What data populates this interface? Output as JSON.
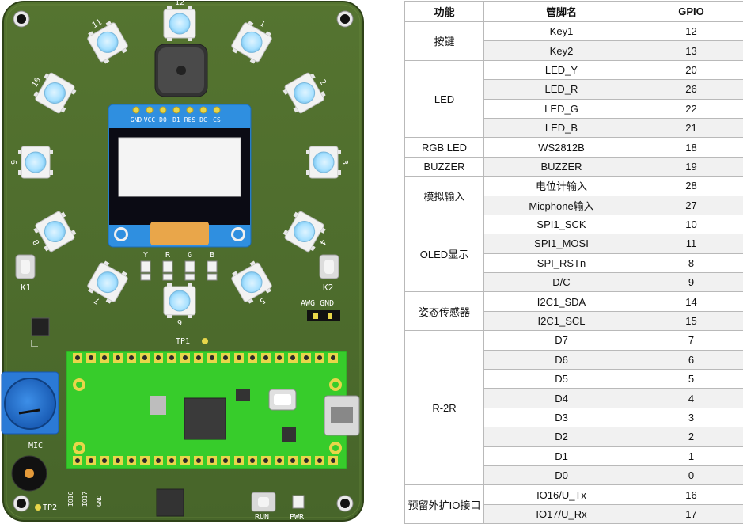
{
  "board": {
    "led_labels": [
      "12",
      "1",
      "2",
      "3",
      "4",
      "5",
      "6",
      "7",
      "8",
      "9",
      "10",
      "11"
    ],
    "oled_pins": [
      "GND",
      "VCC",
      "D0",
      "D1",
      "RES",
      "DC",
      "CS"
    ],
    "rgb_labels": [
      "Y",
      "R",
      "G",
      "B"
    ],
    "key1_label": "K1",
    "key2_label": "K2",
    "tp1_label": "TP1",
    "tp2_label": "TP2",
    "awg_label": "AWG GND",
    "mic_label": "MIC",
    "run_label": "RUN",
    "pwr_label": "PWR",
    "bottom_pins": [
      "IO16",
      "IO17",
      "GND"
    ],
    "colors": {
      "pcb": "#4d6b26",
      "pcb_dark": "#3b5520",
      "pico": "#37cc2b",
      "oled_blue": "#2f8fe0",
      "pot_blue": "#1f70d0",
      "gold": "#e8d64a",
      "led_white": "#f2f2f2",
      "led_cyan": "#a9e1ff"
    }
  },
  "table": {
    "headers": [
      "功能",
      "管脚名",
      "GPIO"
    ],
    "groups": [
      {
        "function": "按键",
        "rows": [
          {
            "pin": "Key1",
            "gpio": "12"
          },
          {
            "pin": "Key2",
            "gpio": "13"
          }
        ]
      },
      {
        "function": "LED",
        "rows": [
          {
            "pin": "LED_Y",
            "gpio": "20"
          },
          {
            "pin": "LED_R",
            "gpio": "26"
          },
          {
            "pin": "LED_G",
            "gpio": "22"
          },
          {
            "pin": "LED_B",
            "gpio": "21"
          }
        ]
      },
      {
        "function": "RGB LED",
        "rows": [
          {
            "pin": "WS2812B",
            "gpio": "18"
          }
        ]
      },
      {
        "function": "BUZZER",
        "rows": [
          {
            "pin": "BUZZER",
            "gpio": "19"
          }
        ]
      },
      {
        "function": "模拟输入",
        "rows": [
          {
            "pin": "电位计输入",
            "gpio": "28"
          },
          {
            "pin": "Micphone输入",
            "gpio": "27"
          }
        ]
      },
      {
        "function": "OLED显示",
        "rows": [
          {
            "pin": "SPI1_SCK",
            "gpio": "10"
          },
          {
            "pin": "SPI1_MOSI",
            "gpio": "11"
          },
          {
            "pin": "SPI_RSTn",
            "gpio": "8"
          },
          {
            "pin": "D/C",
            "gpio": "9"
          }
        ]
      },
      {
        "function": "姿态传感器",
        "rows": [
          {
            "pin": "I2C1_SDA",
            "gpio": "14"
          },
          {
            "pin": "I2C1_SCL",
            "gpio": "15"
          }
        ]
      },
      {
        "function": "R-2R",
        "rows": [
          {
            "pin": "D7",
            "gpio": "7"
          },
          {
            "pin": "D6",
            "gpio": "6"
          },
          {
            "pin": "D5",
            "gpio": "5"
          },
          {
            "pin": "D4",
            "gpio": "4"
          },
          {
            "pin": "D3",
            "gpio": "3"
          },
          {
            "pin": "D2",
            "gpio": "2"
          },
          {
            "pin": "D1",
            "gpio": "1"
          },
          {
            "pin": "D0",
            "gpio": "0"
          }
        ]
      },
      {
        "function": "预留外扩IO接口",
        "rows": [
          {
            "pin": "IO16/U_Tx",
            "gpio": "16"
          },
          {
            "pin": "IO17/U_Rx",
            "gpio": "17"
          }
        ]
      }
    ]
  }
}
